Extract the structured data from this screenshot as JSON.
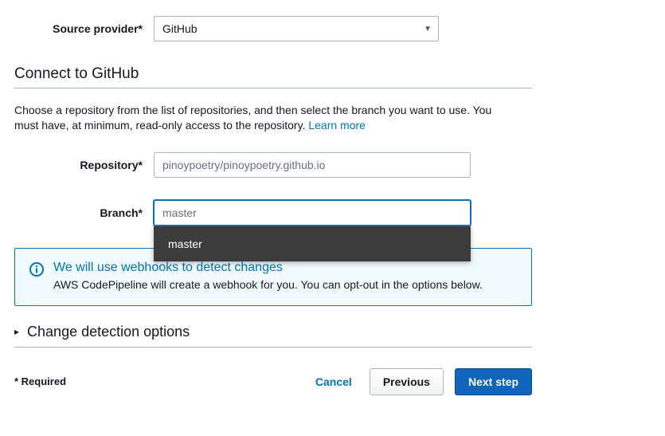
{
  "labels": {
    "source_provider": "Source provider*",
    "repository": "Repository*",
    "branch": "Branch*",
    "required_note": "* Required"
  },
  "source_provider": {
    "selected": "GitHub"
  },
  "section": {
    "connect_title": "Connect to GitHub",
    "description_text": "Choose a repository from the list of repositories, and then select the branch you want to use. You must have, at minimum, read-only access to the repository. ",
    "learn_more": "Learn more"
  },
  "repository": {
    "value": "pinoypoetry/pinoypoetry.github.io"
  },
  "branch": {
    "value": "master",
    "options": [
      "master"
    ]
  },
  "info": {
    "title": "We will use webhooks to detect changes",
    "text": "AWS CodePipeline will create a webhook for you. You can opt-out in the options below."
  },
  "expand": {
    "title": "Change detection options"
  },
  "footer": {
    "cancel": "Cancel",
    "previous": "Previous",
    "next": "Next step"
  }
}
